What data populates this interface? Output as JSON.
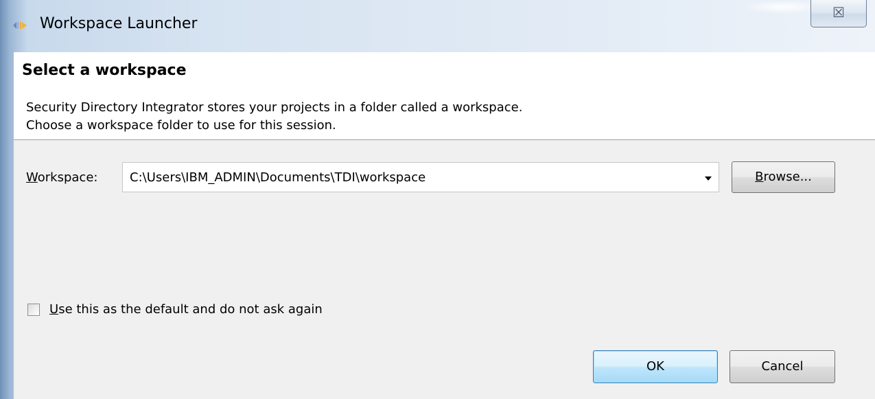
{
  "window": {
    "title": "Workspace Launcher",
    "close_glyph": "☒",
    "icon": "eclipse-launcher-icon"
  },
  "header": {
    "title": "Select a workspace",
    "line1": "Security Directory Integrator stores your projects in a folder called a workspace.",
    "line2": "Choose a workspace folder to use for this session."
  },
  "workspace": {
    "label_mnemonic": "W",
    "label_rest": "orkspace:",
    "value": "C:\\Users\\IBM_ADMIN\\Documents\\TDI\\workspace",
    "browse_mnemonic": "B",
    "browse_rest": "rowse..."
  },
  "default_option": {
    "mnemonic": "U",
    "label_rest": "se this as the default and do not ask again",
    "checked": false
  },
  "buttons": {
    "ok": "OK",
    "cancel": "Cancel"
  },
  "colors": {
    "title_gradient_start": "#6f90b6",
    "title_gradient_end": "#eef3f9",
    "dialog_bg": "#f0f0f0",
    "default_button_border": "#3c7fb1"
  }
}
